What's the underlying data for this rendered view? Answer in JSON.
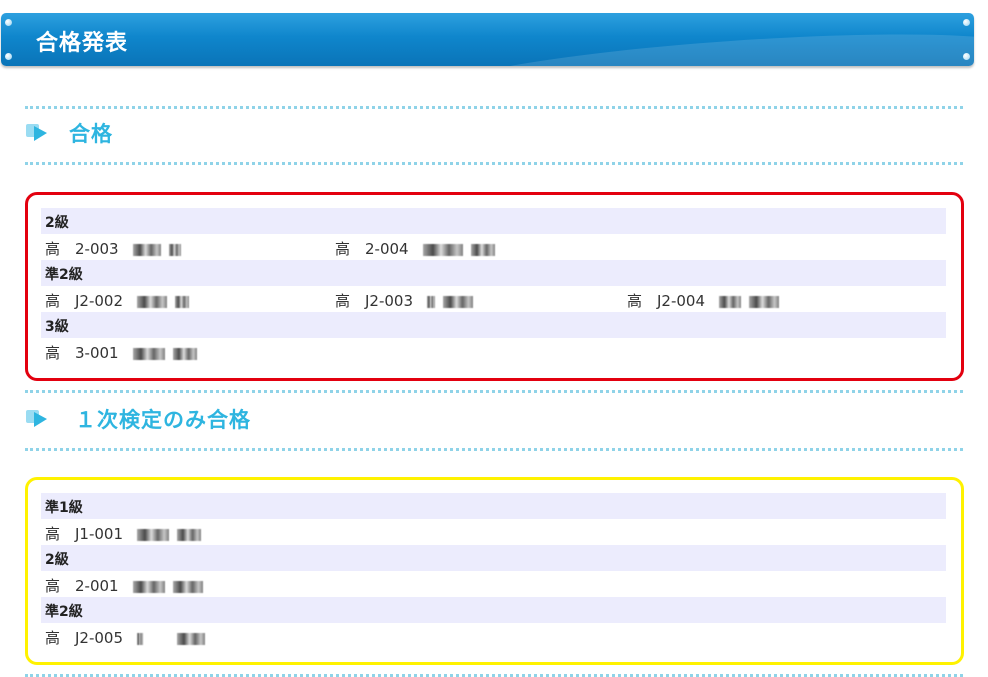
{
  "header": {
    "title": "合格発表"
  },
  "sections": [
    {
      "title": "合格",
      "groups": [
        {
          "grade": "2級",
          "entries": [
            {
              "prefix": "高",
              "number": "2-003"
            },
            {
              "prefix": "高",
              "number": "2-004"
            }
          ]
        },
        {
          "grade": "準2級",
          "entries": [
            {
              "prefix": "高",
              "number": "J2-002"
            },
            {
              "prefix": "高",
              "number": "J2-003"
            },
            {
              "prefix": "高",
              "number": "J2-004"
            }
          ]
        },
        {
          "grade": "3級",
          "entries": [
            {
              "prefix": "高",
              "number": "3-001"
            }
          ]
        }
      ]
    },
    {
      "title": "１次検定のみ合格",
      "groups": [
        {
          "grade": "準1級",
          "entries": [
            {
              "prefix": "高",
              "number": "J1-001"
            }
          ]
        },
        {
          "grade": "2級",
          "entries": [
            {
              "prefix": "高",
              "number": "2-001"
            }
          ]
        },
        {
          "grade": "準2級",
          "entries": [
            {
              "prefix": "高",
              "number": "J2-005"
            }
          ]
        }
      ]
    }
  ]
}
